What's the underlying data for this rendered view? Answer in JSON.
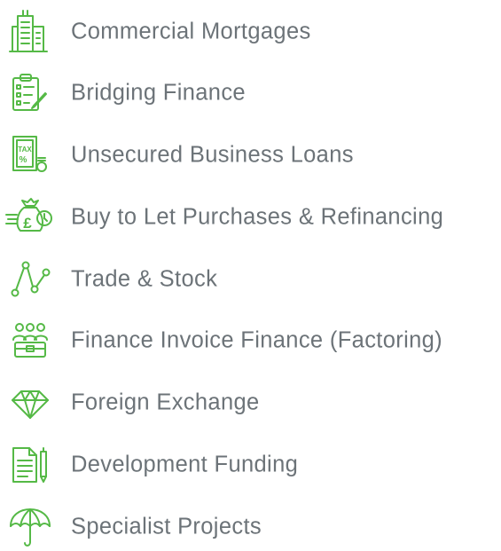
{
  "theme": {
    "icon_color": "#55b946",
    "text_color": "#6c7378"
  },
  "services": [
    {
      "label": "Commercial Mortgages",
      "icon": "office-building-icon"
    },
    {
      "label": "Bridging Finance",
      "icon": "checklist-clipboard-icon"
    },
    {
      "label": "Unsecured Business Loans",
      "icon": "tax-document-icon"
    },
    {
      "label": "Buy to Let Purchases & Refinancing",
      "icon": "money-bag-clock-icon"
    },
    {
      "label": "Trade & Stock",
      "icon": "route-path-icon"
    },
    {
      "label": "Finance Invoice Finance (Factoring)",
      "icon": "team-briefcase-icon"
    },
    {
      "label": "Foreign Exchange",
      "icon": "diamond-icon"
    },
    {
      "label": "Development Funding",
      "icon": "document-pen-icon"
    },
    {
      "label": "Specialist Projects",
      "icon": "umbrella-icon"
    }
  ]
}
